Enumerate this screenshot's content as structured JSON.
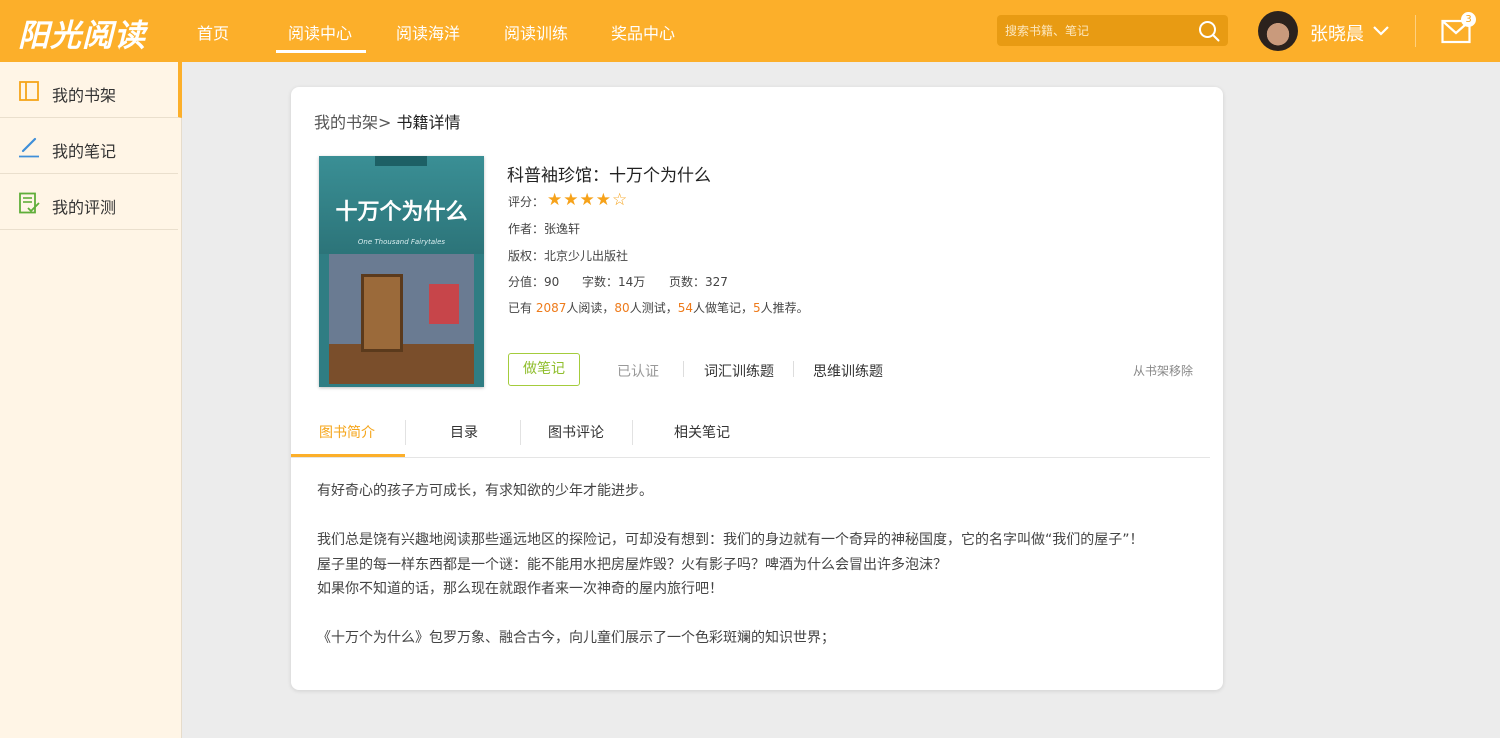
{
  "app": {
    "logo": "阳光阅读"
  },
  "nav": {
    "items": [
      {
        "label": "首页"
      },
      {
        "label": "阅读中心"
      },
      {
        "label": "阅读海洋"
      },
      {
        "label": "阅读训练"
      },
      {
        "label": "奖品中心"
      }
    ],
    "active_index": 1
  },
  "search": {
    "placeholder": "搜索书籍、笔记"
  },
  "user": {
    "name": "张晓晨",
    "mail_count": "3"
  },
  "sidebar": {
    "items": [
      {
        "label": "我的书架",
        "icon": "bookshelf-icon"
      },
      {
        "label": "我的笔记",
        "icon": "pencil-icon"
      },
      {
        "label": "我的评测",
        "icon": "checklist-icon"
      }
    ],
    "active_index": 0
  },
  "breadcrumb": {
    "parent": "我的书架>",
    "current": "书籍详情"
  },
  "book": {
    "cover_title": "十万个为什么",
    "cover_subtitle": "One Thousand Fairytales",
    "title": "科普袖珍馆：十万个为什么",
    "rating_label": "评分：",
    "rating": 4,
    "rating_max": 5,
    "author": "作者：张逸轩",
    "publisher": "版权：北京少儿出版社",
    "score": "分值：90",
    "words": "字数：14万",
    "pages": "页数：327",
    "stats": {
      "prefix": "已有",
      "readers": "2087",
      "readers_suffix": "人阅读，",
      "tested": "80",
      "tested_suffix": "人测试，",
      "notes": "54",
      "notes_suffix": "人做笔记，",
      "recommend": "5",
      "recommend_suffix": "人推荐。"
    }
  },
  "actions": {
    "note": "做笔记",
    "verified": "已认证",
    "vocab": "词汇训练题",
    "thinking": "思维训练题",
    "remove": "从书架移除"
  },
  "tabs": [
    {
      "label": "图书简介"
    },
    {
      "label": "目录"
    },
    {
      "label": "图书评论"
    },
    {
      "label": "相关笔记"
    }
  ],
  "intro": {
    "p1": "有好奇心的孩子方可成长，有求知欲的少年才能进步。",
    "p2": "我们总是饶有兴趣地阅读那些遥远地区的探险记，可却没有想到：我们的身边就有一个奇异的神秘国度，它的名字叫做“我们的屋子”！",
    "p3": "屋子里的每一样东西都是一个谜：能不能用水把房屋炸毁？火有影子吗？啤酒为什么会冒出许多泡沫？",
    "p4": "如果你不知道的话，那么现在就跟作者来一次神奇的屋内旅行吧！",
    "p5": "《十万个为什么》包罗万象、融合古今，向儿童们展示了一个色彩斑斓的知识世界；"
  },
  "colors": {
    "brand": "#fcaf2a",
    "accent": "#ee7b1b",
    "note_green": "#8fbe2c"
  }
}
